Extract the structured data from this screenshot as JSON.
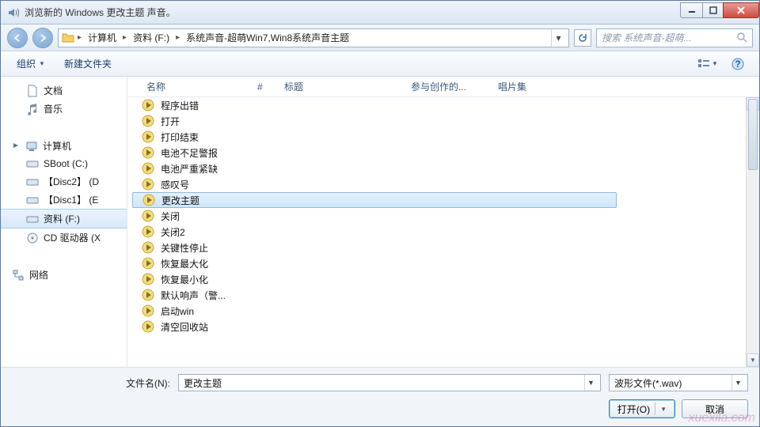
{
  "title": "浏览新的 Windows 更改主题 声音。",
  "breadcrumbs": {
    "c0": "计算机",
    "c1": "资料 (F:)",
    "c2": "系统声音-超萌Win7,Win8系统声音主题"
  },
  "search": {
    "placeholder": "搜索 系统声音-超萌..."
  },
  "toolbar": {
    "organize": "组织",
    "newfolder": "新建文件夹"
  },
  "columns": {
    "name": "名称",
    "num": "#",
    "title": "标题",
    "artist": "参与创作的...",
    "album": "唱片集"
  },
  "nav": {
    "docs": "文档",
    "music": "音乐",
    "computer": "计算机",
    "d0": "SBoot (C:)",
    "d1": "【Disc2】 (D",
    "d2": "【Disc1】 (E",
    "d3": "资料 (F:)",
    "d4": "CD 驱动器 (X",
    "network": "网络"
  },
  "files": {
    "f0": "程序出错",
    "f1": "打开",
    "f2": "打印结束",
    "f3": "电池不足警报",
    "f4": "电池严重紧缺",
    "f5": "感叹号",
    "f6": "更改主题",
    "f7": "关闭",
    "f8": "关闭2",
    "f9": "关键性停止",
    "f10": "恢复最大化",
    "f11": "恢复最小化",
    "f12": "默认响声（警...",
    "f13": "启动win",
    "f14": "清空回收站"
  },
  "footer": {
    "filenameLabel": "文件名(N):",
    "filenameValue": "更改主题",
    "filter": "波形文件(*.wav)",
    "open": "打开(O)",
    "cancel": "取消"
  },
  "watermark": "xuexila.com"
}
